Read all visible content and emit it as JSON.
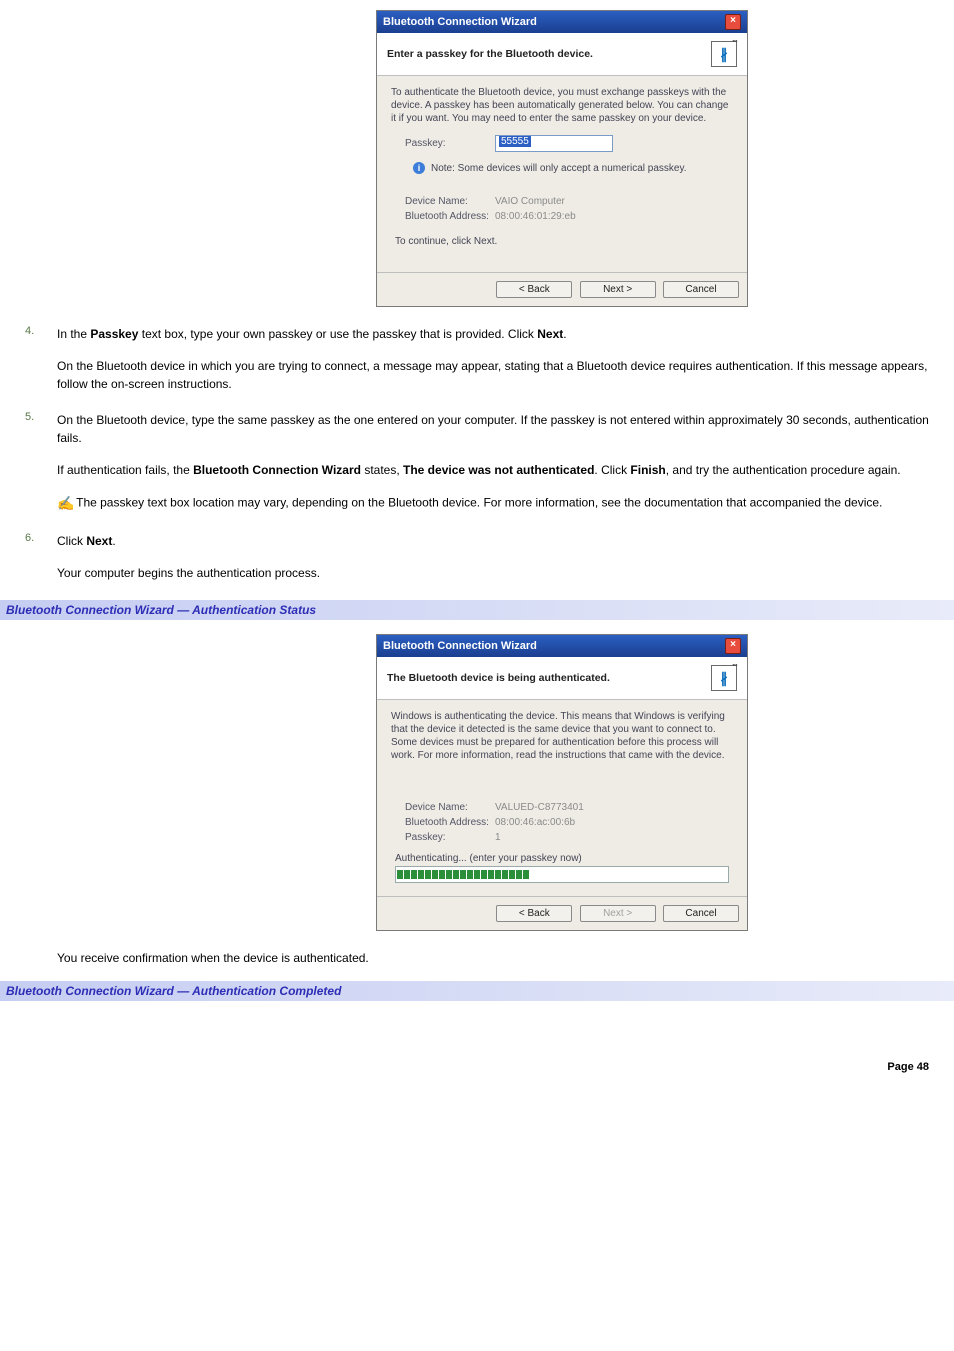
{
  "wiz1": {
    "title": "Bluetooth Connection Wizard",
    "header": "Enter a passkey for the Bluetooth device.",
    "explain": "To authenticate the Bluetooth device, you must exchange passkeys with the device. A passkey has been automatically generated below. You can change it if you want. You may need to enter the same passkey on your device.",
    "passkey_label": "Passkey:",
    "passkey_value": "55555",
    "note": "Note: Some devices will only accept a numerical passkey.",
    "device_name_label": "Device Name:",
    "device_name_value": "VAIO Computer",
    "bt_addr_label": "Bluetooth Address:",
    "bt_addr_value": "08:00:46:01:29:eb",
    "continue": "To continue, click Next.",
    "back": "< Back",
    "next": "Next >",
    "cancel": "Cancel"
  },
  "list": {
    "s4_a": "In the ",
    "s4_b": "Passkey",
    "s4_c": " text box, type your own passkey or use the passkey that is provided. Click ",
    "s4_d": "Next",
    "s4_e": ".",
    "s4_p2": "On the Bluetooth device in which you are trying to connect, a message may appear, stating that a Bluetooth device requires authentication. If this message appears, follow the on-screen instructions.",
    "s5_p1": "On the Bluetooth device, type the same passkey as the one entered on your computer. If the passkey is not entered within approximately 30 seconds, authentication fails.",
    "s5_p2a": "If authentication fails, the ",
    "s5_p2b": "Bluetooth Connection Wizard",
    "s5_p2c": " states, ",
    "s5_p2d": "The device was not authenticated",
    "s5_p2e": ". Click ",
    "s5_p2f": "Finish",
    "s5_p2g": ", and try the authentication procedure again.",
    "s5_note": " The passkey text box location may vary, depending on the Bluetooth device. For more information, see the documentation that accompanied the device.",
    "s6_a": "Click ",
    "s6_b": "Next",
    "s6_c": ".",
    "s6_p2": "Your computer begins the authentication process."
  },
  "heading1": "Bluetooth Connection Wizard — Authentication Status",
  "wiz2": {
    "title": "Bluetooth Connection Wizard",
    "header": "The Bluetooth device is being authenticated.",
    "explain": "Windows is authenticating the device. This means that Windows is verifying that the device it detected is the same device that you want to connect to. Some devices must be prepared for authentication before this process will work. For more information, read the instructions that came with the device.",
    "device_name_label": "Device Name:",
    "device_name_value": "VALUED-C8773401",
    "bt_addr_label": "Bluetooth Address:",
    "bt_addr_value": "08:00:46:ac:00:6b",
    "passkey_label": "Passkey:",
    "passkey_value": "1",
    "auth_line": "Authenticating... (enter your passkey now)",
    "back": "< Back",
    "next": "Next >",
    "cancel": "Cancel"
  },
  "confirm_line": "You receive confirmation when the device is authenticated.",
  "heading2": "Bluetooth Connection Wizard — Authentication Completed",
  "page_footer": "Page 48"
}
